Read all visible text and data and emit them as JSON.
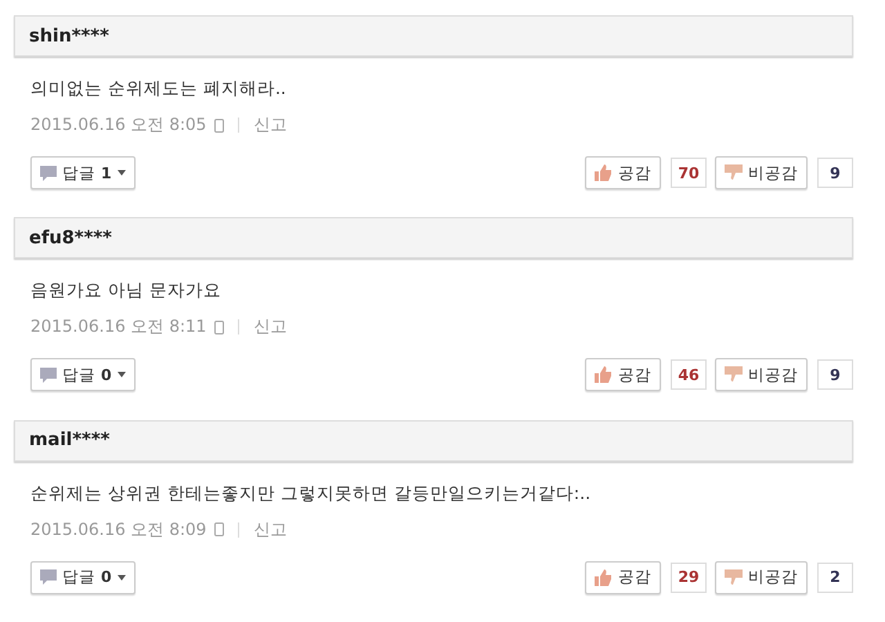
{
  "comments": [
    {
      "user": "shin****",
      "text": "의미없는 순위제도는 폐지해라..",
      "date": "2015.06.16 오전 8:05",
      "report": "신고",
      "reply_label": "답글",
      "reply_count": "1",
      "like_label": "공감",
      "likes": "70",
      "dislike_label": "비공감",
      "dislikes": "9"
    },
    {
      "user": "efu8****",
      "text": "음원가요 아님 문자가요",
      "date": "2015.06.16 오전 8:11",
      "report": "신고",
      "reply_label": "답글",
      "reply_count": "0",
      "like_label": "공감",
      "likes": "46",
      "dislike_label": "비공감",
      "dislikes": "9"
    },
    {
      "user": "mail****",
      "text": "순위제는 상위권 한테는좋지만 그렇지못하면 갈등만일으키는거같다:..",
      "date": "2015.06.16 오전 8:09",
      "report": "신고",
      "reply_label": "답글",
      "reply_count": "0",
      "like_label": "공감",
      "likes": "29",
      "dislike_label": "비공감",
      "dislikes": "2"
    }
  ]
}
